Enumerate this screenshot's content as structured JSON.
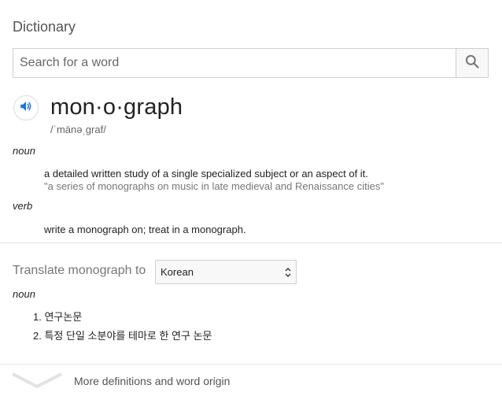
{
  "header": {
    "title": "Dictionary"
  },
  "search": {
    "placeholder": "Search for a word",
    "value": "",
    "button_icon": "search-icon"
  },
  "entry": {
    "speaker_icon": "speaker-icon",
    "headword": "mon·o·graph",
    "pronunciation": "/ˈmänəˌɡraf/",
    "senses": [
      {
        "pos": "noun",
        "definition": "a detailed written study of a single specialized subject or an aspect of it.",
        "example": "\"a series of monographs on music in late medieval and Renaissance cities\""
      },
      {
        "pos": "verb",
        "definition": "write a monograph on; treat in a monograph."
      }
    ]
  },
  "translate": {
    "label": "Translate monograph to",
    "selected_language": "Korean",
    "pos": "noun",
    "items": [
      {
        "num": "1.",
        "text": "연구논문"
      },
      {
        "num": "2.",
        "text": "특정 단일 소분야를 테마로 한 연구 논문"
      }
    ]
  },
  "footer": {
    "more_label": "More definitions and word origin",
    "chevron_icon": "chevron-down-icon"
  },
  "colors": {
    "accent": "#1a73e8",
    "icon_gray": "#757575",
    "divider": "#e6e6e6"
  }
}
